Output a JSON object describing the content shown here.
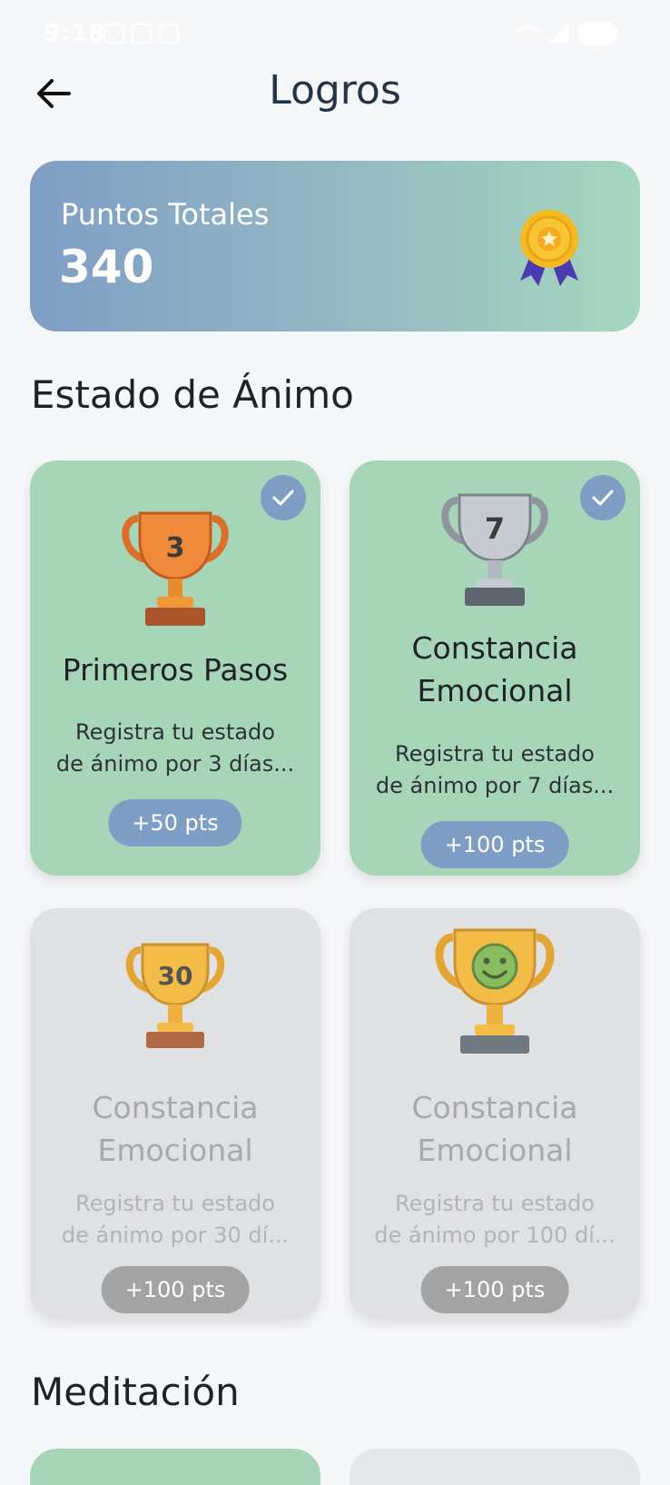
{
  "status_bar": {
    "time": "9:18"
  },
  "header": {
    "title": "Logros",
    "back_icon": "arrow-left-icon"
  },
  "points_card": {
    "label": "Puntos Totales",
    "value": "340",
    "icon": "medal-icon"
  },
  "sections": [
    {
      "title": "Estado de Ánimo",
      "achievements": [
        {
          "title_line1": "Primeros Pasos",
          "title_line2": "",
          "description_line1": "Registra tu estado",
          "description_line2": "de ánimo por 3 días...",
          "points": "+50 pts",
          "unlocked": true,
          "trophy_text": "3",
          "trophy_icon": "bronze-trophy-icon"
        },
        {
          "title_line1": "Constancia",
          "title_line2": "Emocional",
          "description_line1": "Registra tu estado",
          "description_line2": "de ánimo por 7 días...",
          "points": "+100 pts",
          "unlocked": true,
          "trophy_text": "7",
          "trophy_icon": "silver-trophy-icon"
        },
        {
          "title_line1": "Constancia",
          "title_line2": "Emocional",
          "description_line1": "Registra tu estado",
          "description_line2": "de ánimo por 30 dí...",
          "points": "+100 pts",
          "unlocked": false,
          "trophy_text": "30",
          "trophy_icon": "gold-trophy-icon"
        },
        {
          "title_line1": "Constancia",
          "title_line2": "Emocional",
          "description_line1": "Registra tu estado",
          "description_line2": "de ánimo por 100 dí...",
          "points": "+100 pts",
          "unlocked": false,
          "trophy_text": "",
          "trophy_icon": "smiley-trophy-icon"
        }
      ]
    },
    {
      "title": "Meditación"
    }
  ],
  "colors": {
    "accent": "#7f9ec6",
    "unlocked_card": "#a7d5b8",
    "locked_card": "#e0e1e3",
    "title": "#243447"
  }
}
